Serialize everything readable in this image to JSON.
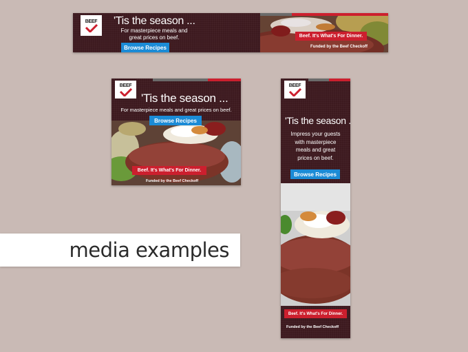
{
  "caption": "media examples",
  "brand": {
    "logo_text": "BEEF",
    "accent_red": "#cc1f2e",
    "button_blue": "#1b8bd6",
    "panel_maroon": "#3d1a1f"
  },
  "leaderboard": {
    "headline": "'Tis the season ...",
    "subline_1": "For masterpiece meals and",
    "subline_2": "great prices on beef.",
    "button": "Browse Recipes",
    "tagline": "Beef. It's What's For Dinner.",
    "funded": "Funded by the Beef Checkoff"
  },
  "square": {
    "headline": "'Tis the season ...",
    "subline": "For masterpiece meals and great prices on beef.",
    "button": "Browse Recipes",
    "tagline": "Beef. It's What's For Dinner.",
    "funded": "Funded by the Beef Checkoff"
  },
  "skyscraper": {
    "headline": "'Tis the season ...",
    "lines": [
      "Impress your guests",
      "with masterpiece",
      "meals and great",
      "prices on beef."
    ],
    "button": "Browse Recipes",
    "tagline": "Beef. It's What's For Dinner.",
    "funded": "Funded by the Beef Checkoff"
  }
}
